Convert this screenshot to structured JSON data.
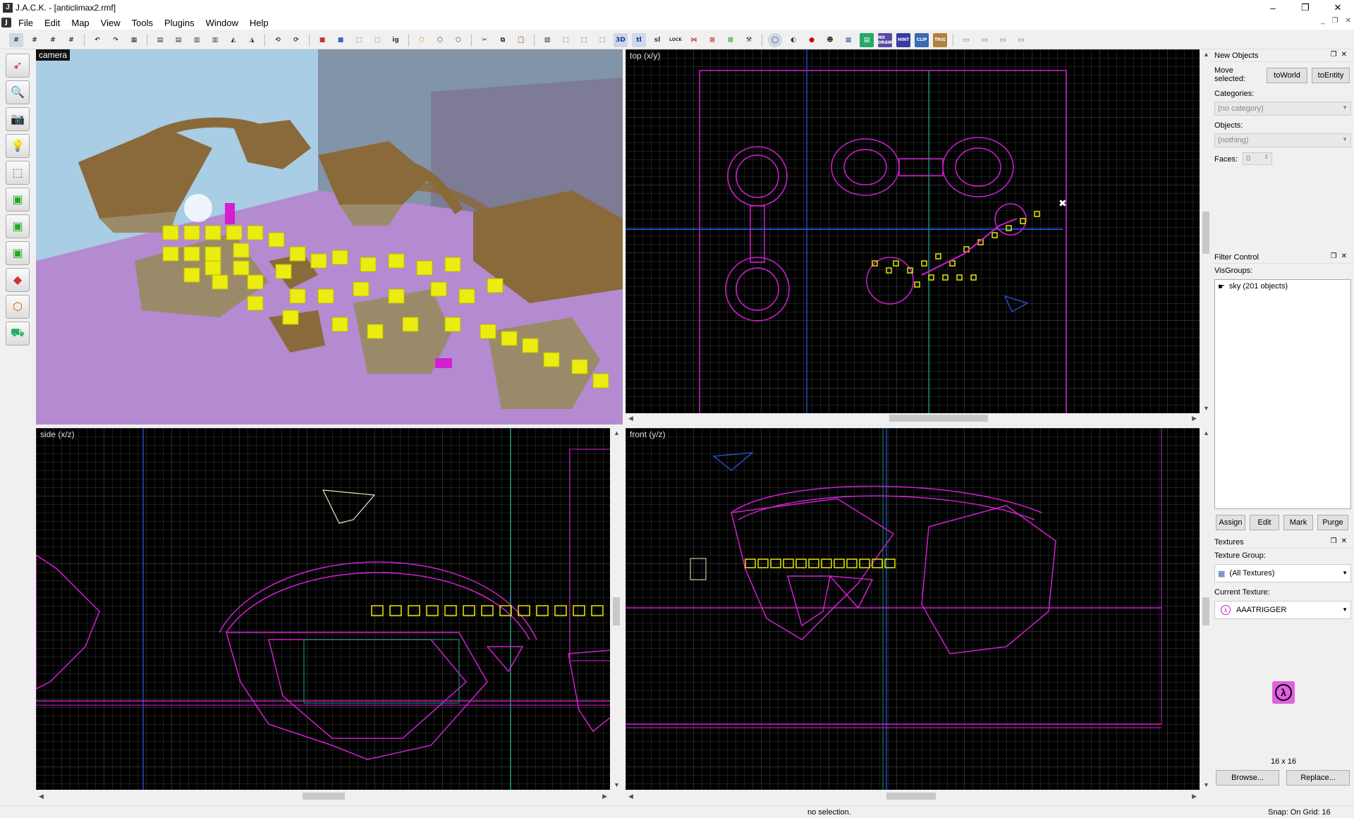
{
  "window": {
    "title": "J.A.C.K. - [anticlimax2.rmf]",
    "app_icon": "J",
    "controls": [
      "–",
      "❐",
      "✕"
    ],
    "mdi_controls": [
      "_",
      "❐",
      "✕"
    ]
  },
  "menu": [
    "File",
    "Edit",
    "Map",
    "View",
    "Tools",
    "Plugins",
    "Window",
    "Help"
  ],
  "toolbar": {
    "labels": {
      "t1": "3D",
      "t2": "tl",
      "t3": "sl",
      "t4": "NO DRAW",
      "t5": "HINT",
      "t6": "CLIP",
      "t7": "TRIG",
      "t8": "ig",
      "t9": "LOCK"
    }
  },
  "viewports": {
    "camera": {
      "label": "camera"
    },
    "top": {
      "label": "top (x/y)"
    },
    "side": {
      "label": "side (x/z)"
    },
    "front": {
      "label": "front (y/z)"
    }
  },
  "new_objects": {
    "title": "New Objects",
    "move_selected": "Move selected:",
    "to_world": "toWorld",
    "to_entity": "toEntity",
    "categories_label": "Categories:",
    "categories_value": "(no category)",
    "objects_label": "Objects:",
    "objects_value": "(nothing)",
    "faces_label": "Faces:",
    "faces_value": "0"
  },
  "filter_control": {
    "title": "Filter Control",
    "visgroups_label": "VisGroups:",
    "visgroups": [
      "sky (201 objects)"
    ],
    "buttons": {
      "assign": "Assign",
      "edit": "Edit",
      "mark": "Mark",
      "purge": "Purge"
    }
  },
  "textures": {
    "title": "Textures",
    "group_label": "Texture Group:",
    "group_value": "(All Textures)",
    "current_label": "Current Texture:",
    "current_value": "AAATRIGGER",
    "size": "16 x 16",
    "browse": "Browse...",
    "replace": "Replace..."
  },
  "status": {
    "left": "no selection.",
    "right": "Snap: On Grid: 16"
  },
  "colors": {
    "grid_bg": "#000000",
    "brush": "#d020d0",
    "accent_yellow": "#e8e800",
    "axis_blue": "#1f4fbf",
    "axis_teal": "#1a8a7a"
  }
}
